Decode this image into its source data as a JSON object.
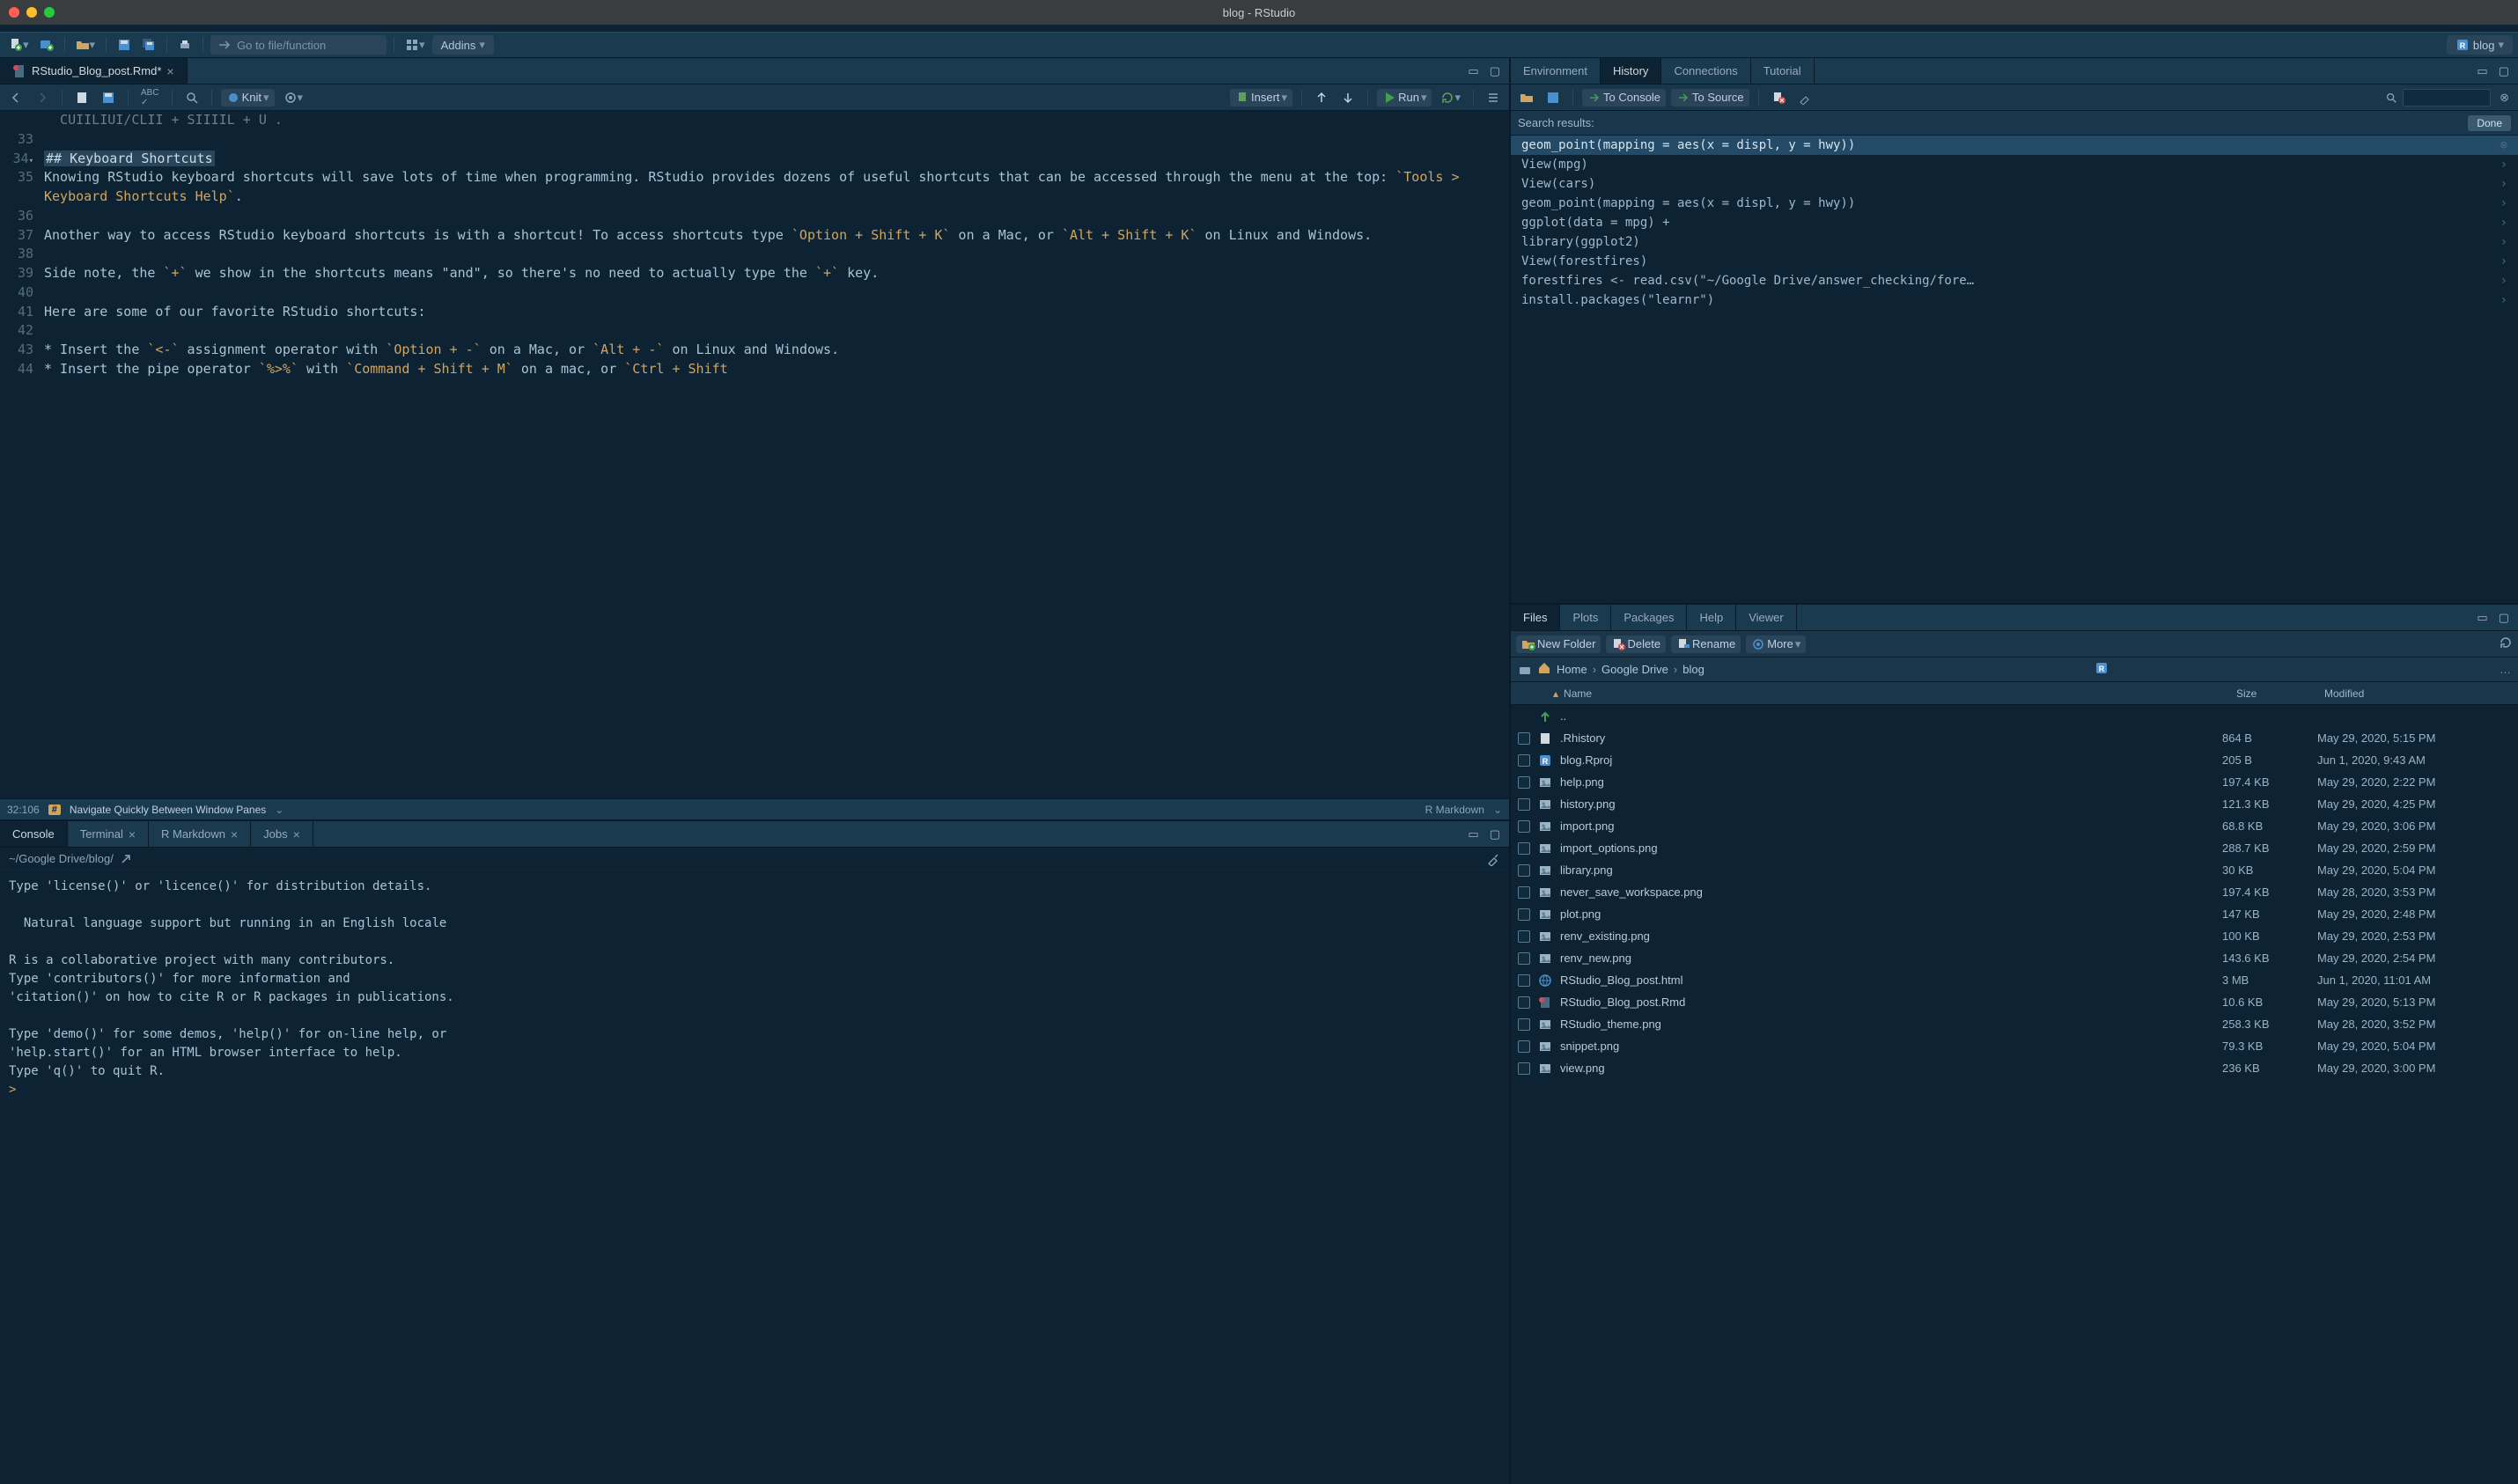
{
  "window": {
    "title": "blog - RStudio"
  },
  "main_toolbar": {
    "goto_placeholder": "Go to file/function",
    "addins_label": "Addins",
    "project_label": "blog"
  },
  "source_pane": {
    "tab_title": "RStudio_Blog_post.Rmd*",
    "knit_label": "Knit",
    "insert_label": "Insert",
    "run_label": "Run",
    "cursor_pos": "32:106",
    "nav_label": "Navigate Quickly Between Window Panes",
    "doc_type": "R Markdown",
    "lines": [
      {
        "num": "33",
        "spans": []
      },
      {
        "num": "34",
        "marker": true,
        "spans": [
          {
            "cls": "tok-heading",
            "t": "## Keyboard Shortcuts"
          }
        ]
      },
      {
        "num": "35",
        "spans": [
          {
            "cls": "tok-text",
            "t": "Knowing RStudio keyboard shortcuts will save lots of time when programming. RStudio provides dozens of useful shortcuts that can be accessed through the menu at the top: "
          },
          {
            "cls": "tok-code",
            "t": "`Tools > Keyboard Shortcuts Help`"
          },
          {
            "cls": "tok-text",
            "t": "."
          }
        ]
      },
      {
        "num": "36",
        "spans": []
      },
      {
        "num": "37",
        "spans": [
          {
            "cls": "tok-text",
            "t": "Another way to access RStudio keyboard shortcuts is with a shortcut! To access shortcuts type "
          },
          {
            "cls": "tok-code",
            "t": "`Option + Shift + K`"
          },
          {
            "cls": "tok-text",
            "t": " on a Mac, or "
          },
          {
            "cls": "tok-code",
            "t": "`Alt + Shift + K`"
          },
          {
            "cls": "tok-text",
            "t": " on Linux and Windows."
          }
        ]
      },
      {
        "num": "38",
        "spans": []
      },
      {
        "num": "39",
        "spans": [
          {
            "cls": "tok-text",
            "t": "Side note, the "
          },
          {
            "cls": "tok-code",
            "t": "`+`"
          },
          {
            "cls": "tok-text",
            "t": " we show in the shortcuts means \"and\", so there's no need to actually type the "
          },
          {
            "cls": "tok-code",
            "t": "`+`"
          },
          {
            "cls": "tok-text",
            "t": " key."
          }
        ]
      },
      {
        "num": "40",
        "spans": []
      },
      {
        "num": "41",
        "spans": [
          {
            "cls": "tok-text",
            "t": "Here are some of our favorite RStudio shortcuts:"
          }
        ]
      },
      {
        "num": "42",
        "spans": []
      },
      {
        "num": "43",
        "spans": [
          {
            "cls": "tok-text",
            "t": "* Insert the "
          },
          {
            "cls": "tok-code",
            "t": "`<-`"
          },
          {
            "cls": "tok-text",
            "t": " assignment operator with "
          },
          {
            "cls": "tok-code",
            "t": "`Option + -`"
          },
          {
            "cls": "tok-text",
            "t": " on a Mac, or "
          },
          {
            "cls": "tok-code",
            "t": "`Alt + -`"
          },
          {
            "cls": "tok-text",
            "t": " on Linux and Windows."
          }
        ]
      },
      {
        "num": "44",
        "spans": [
          {
            "cls": "tok-text",
            "t": "* Insert the pipe operator "
          },
          {
            "cls": "tok-code",
            "t": "`%>%`"
          },
          {
            "cls": "tok-text",
            "t": " with "
          },
          {
            "cls": "tok-code",
            "t": "`Command + Shift + M`"
          },
          {
            "cls": "tok-text",
            "t": " on a mac, or "
          },
          {
            "cls": "tok-code",
            "t": "`Ctrl + Shift"
          }
        ]
      }
    ]
  },
  "console_pane": {
    "tabs": [
      "Console",
      "Terminal",
      "R Markdown",
      "Jobs"
    ],
    "active_tab": 0,
    "path": "~/Google Drive/blog/",
    "output": "Type 'license()' or 'licence()' for distribution details.\n\n  Natural language support but running in an English locale\n\nR is a collaborative project with many contributors.\nType 'contributors()' for more information and\n'citation()' on how to cite R or R packages in publications.\n\nType 'demo()' for some demos, 'help()' for on-line help, or\n'help.start()' for an HTML browser interface to help.\nType 'q()' to quit R.\n",
    "prompt": "> "
  },
  "history_pane": {
    "tabs": [
      "Environment",
      "History",
      "Connections",
      "Tutorial"
    ],
    "active_tab": 1,
    "to_console_label": "To Console",
    "to_source_label": "To Source",
    "search_label": "Search results:",
    "done_label": "Done",
    "items": [
      {
        "t": "geom_point(mapping = aes(x = displ, y = hwy))",
        "selected": true,
        "x": true
      },
      {
        "t": "View(mpg)"
      },
      {
        "t": "View(cars)"
      },
      {
        "t": "geom_point(mapping = aes(x = displ, y = hwy))"
      },
      {
        "t": "ggplot(data = mpg) +"
      },
      {
        "t": "library(ggplot2)"
      },
      {
        "t": "View(forestfires)"
      },
      {
        "t": "forestfires <- read.csv(\"~/Google Drive/answer_checking/fore…"
      },
      {
        "t": "install.packages(\"learnr\")"
      }
    ]
  },
  "files_pane": {
    "tabs": [
      "Files",
      "Plots",
      "Packages",
      "Help",
      "Viewer"
    ],
    "active_tab": 0,
    "toolbar": {
      "new_folder": "New Folder",
      "delete": "Delete",
      "rename": "Rename",
      "more": "More"
    },
    "breadcrumb": [
      "Home",
      "Google Drive",
      "blog"
    ],
    "headers": {
      "name": "Name",
      "size": "Size",
      "modified": "Modified"
    },
    "up_label": "..",
    "files": [
      {
        "name": ".Rhistory",
        "icon": "doc",
        "size": "864 B",
        "mod": "May 29, 2020, 5:15 PM"
      },
      {
        "name": "blog.Rproj",
        "icon": "rproj",
        "size": "205 B",
        "mod": "Jun 1, 2020, 9:43 AM"
      },
      {
        "name": "help.png",
        "icon": "img",
        "size": "197.4 KB",
        "mod": "May 29, 2020, 2:22 PM"
      },
      {
        "name": "history.png",
        "icon": "img",
        "size": "121.3 KB",
        "mod": "May 29, 2020, 4:25 PM"
      },
      {
        "name": "import.png",
        "icon": "img",
        "size": "68.8 KB",
        "mod": "May 29, 2020, 3:06 PM"
      },
      {
        "name": "import_options.png",
        "icon": "img",
        "size": "288.7 KB",
        "mod": "May 29, 2020, 2:59 PM"
      },
      {
        "name": "library.png",
        "icon": "img",
        "size": "30 KB",
        "mod": "May 29, 2020, 5:04 PM"
      },
      {
        "name": "never_save_workspace.png",
        "icon": "img",
        "size": "197.4 KB",
        "mod": "May 28, 2020, 3:53 PM"
      },
      {
        "name": "plot.png",
        "icon": "img",
        "size": "147 KB",
        "mod": "May 29, 2020, 2:48 PM"
      },
      {
        "name": "renv_existing.png",
        "icon": "img",
        "size": "100 KB",
        "mod": "May 29, 2020, 2:53 PM"
      },
      {
        "name": "renv_new.png",
        "icon": "img",
        "size": "143.6 KB",
        "mod": "May 29, 2020, 2:54 PM"
      },
      {
        "name": "RStudio_Blog_post.html",
        "icon": "html",
        "size": "3 MB",
        "mod": "Jun 1, 2020, 11:01 AM"
      },
      {
        "name": "RStudio_Blog_post.Rmd",
        "icon": "rmd",
        "size": "10.6 KB",
        "mod": "May 29, 2020, 5:13 PM"
      },
      {
        "name": "RStudio_theme.png",
        "icon": "img",
        "size": "258.3 KB",
        "mod": "May 28, 2020, 3:52 PM"
      },
      {
        "name": "snippet.png",
        "icon": "img",
        "size": "79.3 KB",
        "mod": "May 29, 2020, 5:04 PM"
      },
      {
        "name": "view.png",
        "icon": "img",
        "size": "236 KB",
        "mod": "May 29, 2020, 3:00 PM"
      }
    ]
  }
}
